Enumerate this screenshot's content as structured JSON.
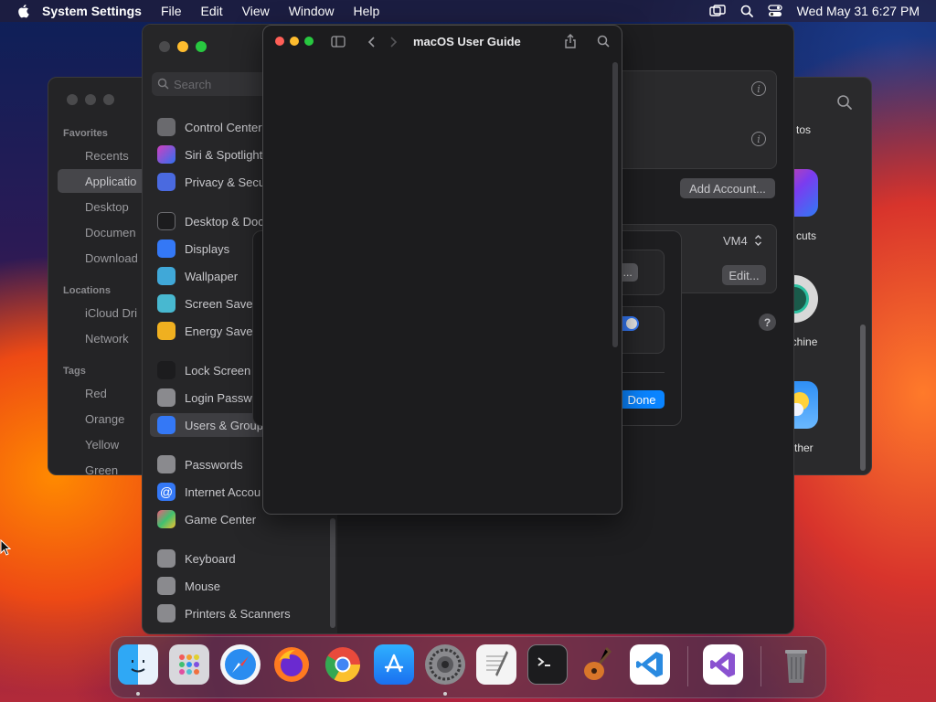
{
  "menubar": {
    "app_name": "System Settings",
    "items": [
      "File",
      "Edit",
      "View",
      "Window",
      "Help"
    ],
    "datetime": "Wed May 31  6:27 PM"
  },
  "finder": {
    "sections": {
      "favorites": "Favorites",
      "locations": "Locations",
      "tags": "Tags"
    },
    "favorites": [
      "Recents",
      "Applicatio",
      "Desktop",
      "Documen",
      "Download"
    ],
    "locations": [
      "iCloud Dri",
      "Network"
    ],
    "tags": [
      "Red",
      "Orange",
      "Yellow",
      "Green"
    ],
    "apps": [
      "tos",
      "cuts",
      "achine",
      "ther"
    ]
  },
  "settings": {
    "search_placeholder": "Search",
    "items": [
      "Control Center",
      "Siri & Spotlight",
      "Privacy & Secu",
      "Desktop & Doc",
      "Displays",
      "Wallpaper",
      "Screen Saver",
      "Energy Saver",
      "Lock Screen",
      "Login Passwo",
      "Users & Group",
      "Passwords",
      "Internet Accou",
      "Game Center",
      "Keyboard",
      "Mouse",
      "Printers & Scanners"
    ],
    "add_account": "Add Account...",
    "vm_value": "VM4",
    "edit": "Edit...",
    "help": "?"
  },
  "sheet": {
    "password_button": "ord...",
    "done": "Done"
  },
  "guide": {
    "title": "macOS User Guide"
  },
  "dock": {
    "apps": [
      "Finder",
      "Launchpad",
      "Safari",
      "Firefox",
      "Chrome",
      "App Store",
      "System Settings",
      "TextEdit",
      "Terminal",
      "GarageBand",
      "Visual Studio Code",
      "Visual Studio",
      "Trash"
    ]
  },
  "colors": {
    "close": "#ff5f57",
    "minimize": "#febc2e",
    "zoom": "#28c840",
    "accent": "#0a84ff"
  }
}
